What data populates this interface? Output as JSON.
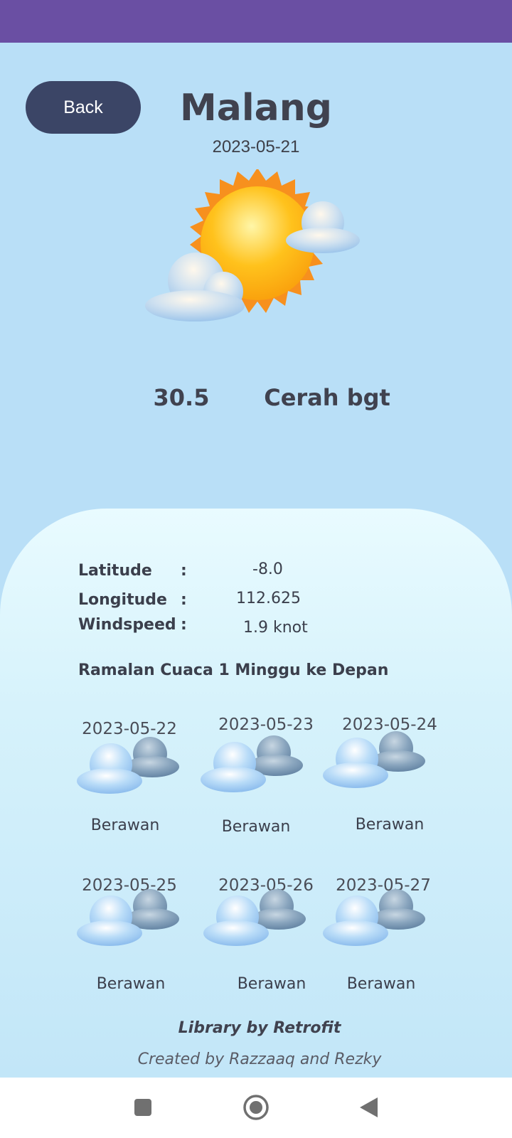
{
  "header": {
    "back_label": "Back",
    "city": "Malang",
    "date": "2023-05-21"
  },
  "current": {
    "icon": "sun-cloud-icon",
    "temperature": "30.5",
    "condition": "Cerah bgt"
  },
  "details": {
    "latitude_label": "Latitude",
    "latitude_value": "-8.0",
    "longitude_label": "Longitude",
    "longitude_value": "112.625",
    "windspeed_label": "Windspeed",
    "windspeed_value": "1.9 knot",
    "colon": ":"
  },
  "forecast": {
    "heading": "Ramalan Cuaca 1 Minggu ke Depan",
    "days": [
      {
        "date": "2023-05-22",
        "condition": "Berawan",
        "icon": "cloudy-icon"
      },
      {
        "date": "2023-05-23",
        "condition": "Berawan",
        "icon": "cloudy-icon"
      },
      {
        "date": "2023-05-24",
        "condition": "Berawan",
        "icon": "cloudy-icon"
      },
      {
        "date": "2023-05-25",
        "condition": "Berawan",
        "icon": "cloudy-icon"
      },
      {
        "date": "2023-05-26",
        "condition": "Berawan",
        "icon": "cloudy-icon"
      },
      {
        "date": "2023-05-27",
        "condition": "Berawan",
        "icon": "cloudy-icon"
      }
    ]
  },
  "footer": {
    "library": "Library by Retrofit",
    "created": "Created by Razzaaq and Rezky"
  },
  "colors": {
    "status_bar": "#6a4fa3",
    "background": "#b9dff7",
    "back_button": "#3b4566"
  }
}
